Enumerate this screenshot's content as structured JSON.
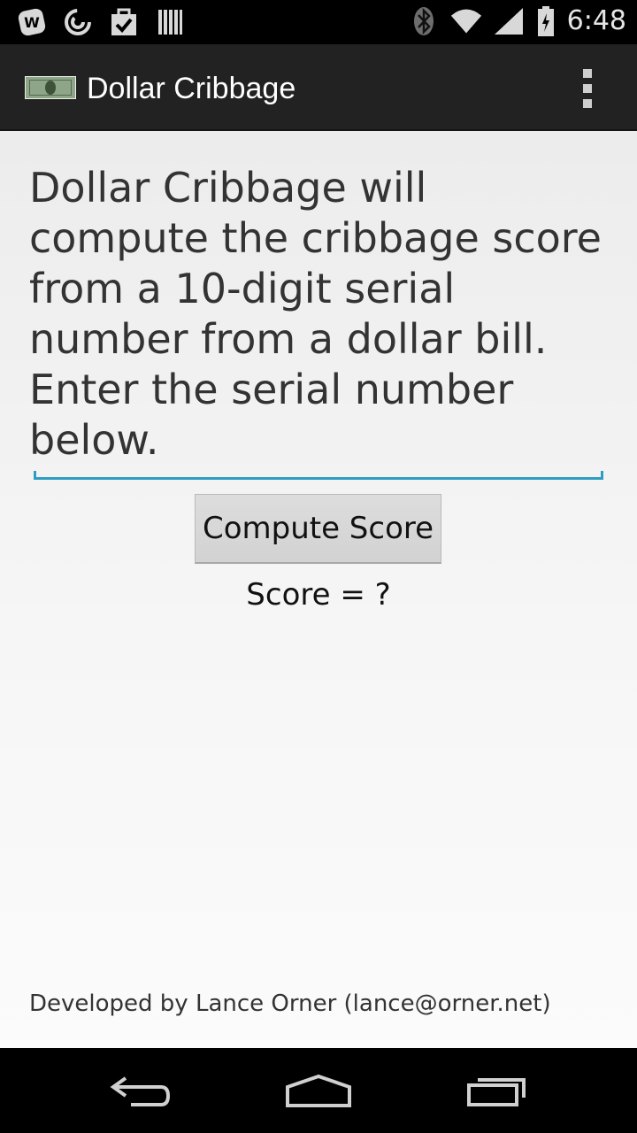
{
  "status_bar": {
    "left_icons": [
      "wikipedia-icon",
      "sync-icon",
      "tasks-icon",
      "barcode-icon"
    ],
    "right_icons": [
      "bluetooth-icon",
      "wifi-icon",
      "signal-icon",
      "battery-icon"
    ],
    "time": "6:48"
  },
  "action_bar": {
    "app_icon": "dollar-bill-icon",
    "title": "Dollar Cribbage",
    "overflow_icon": "overflow-menu-icon"
  },
  "main": {
    "description": "Dollar Cribbage will compute the cribbage score from a 10-digit serial number from a dollar bill. Enter the serial number below.",
    "serial_input": {
      "value": "",
      "placeholder": ""
    },
    "compute_button_label": "Compute Score",
    "score_text": "Score = ?",
    "footer_credit": "Developed by Lance Orner (lance@orner.net)"
  },
  "nav_bar": {
    "icons": [
      "back-icon",
      "home-icon",
      "recents-icon"
    ]
  },
  "colors": {
    "action_bar_bg": "#222222",
    "input_underline": "#2e9dc1",
    "button_bg": "#d8d8d8"
  }
}
